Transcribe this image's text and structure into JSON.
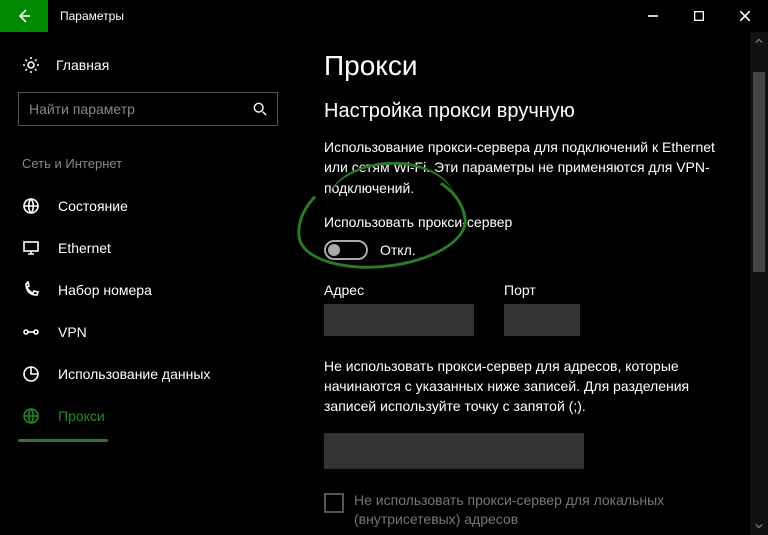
{
  "titlebar": {
    "app_title": "Параметры"
  },
  "sidebar": {
    "home_label": "Главная",
    "search_placeholder": "Найти параметр",
    "category_label": "Сеть и Интернет",
    "items": [
      {
        "label": "Состояние"
      },
      {
        "label": "Ethernet"
      },
      {
        "label": "Набор номера"
      },
      {
        "label": "VPN"
      },
      {
        "label": "Использование данных"
      },
      {
        "label": "Прокси"
      }
    ]
  },
  "content": {
    "h1": "Прокси",
    "h2": "Настройка прокси вручную",
    "description": "Использование прокси-сервера для подключений к Ethernet или сетям Wi-Fi. Эти параметры не применяются для VPN-подключений.",
    "toggle_title": "Использовать прокси-сервер",
    "toggle_state": "Откл.",
    "address_label": "Адрес",
    "port_label": "Порт",
    "bypass_text": "Не использовать прокси-сервер для адресов, которые начинаются с указанных ниже записей. Для разделения записей используйте точку с запятой (;).",
    "checkbox_label": "Не использовать прокси-сервер для локальных (внутрисетевых) адресов"
  }
}
